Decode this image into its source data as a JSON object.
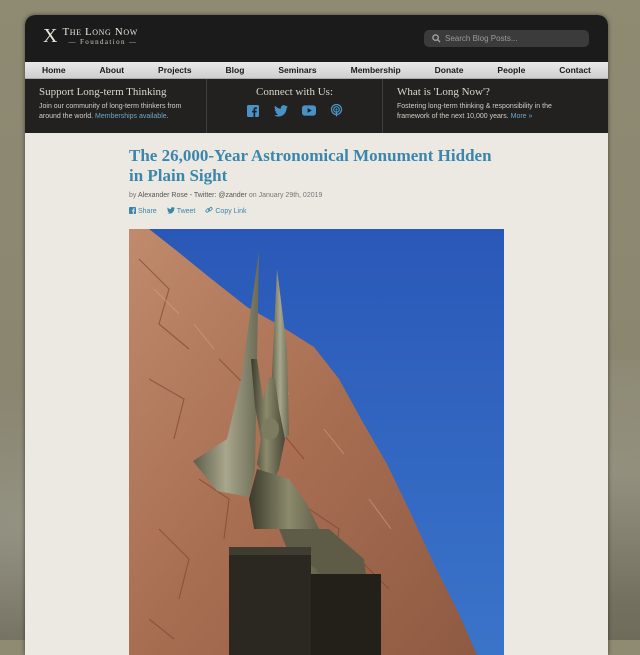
{
  "header": {
    "logo_mark": "X",
    "logo_line1": "The Long Now",
    "logo_line2": "— Foundation —",
    "search_placeholder": "Search Blog Posts..."
  },
  "nav": {
    "items": [
      {
        "label": "Home"
      },
      {
        "label": "About"
      },
      {
        "label": "Projects"
      },
      {
        "label": "Blog"
      },
      {
        "label": "Seminars"
      },
      {
        "label": "Membership"
      },
      {
        "label": "Donate"
      },
      {
        "label": "People"
      },
      {
        "label": "Contact"
      }
    ]
  },
  "info": {
    "support": {
      "title": "Support Long-term Thinking",
      "text": "Join our community of long-term thinkers from around the world.",
      "link": "Memberships available",
      "after": "."
    },
    "connect": {
      "title": "Connect with Us:",
      "icons": [
        "facebook-icon",
        "twitter-icon",
        "youtube-icon",
        "podcast-icon"
      ]
    },
    "what": {
      "title": "What is 'Long Now'?",
      "text": "Fostering long-term thinking & responsibility in the framework of the next 10,000 years.",
      "link": "More »"
    }
  },
  "article": {
    "title": "The 26,000-Year Astronomical Monument Hidden in Plain Sight",
    "byline_prefix": "by",
    "byline_author": "Alexander Rose - Twitter: @zander",
    "byline_date": "on January 29th, 02019",
    "share": {
      "facebook": "Share",
      "twitter": "Tweet",
      "copy": "Copy Link"
    }
  },
  "colors": {
    "accent": "#3b86ad",
    "header_bg": "#1b1b1b",
    "page_bg": "#ebe9e1",
    "sky": "#2f5db3",
    "rock": "#b07858"
  }
}
